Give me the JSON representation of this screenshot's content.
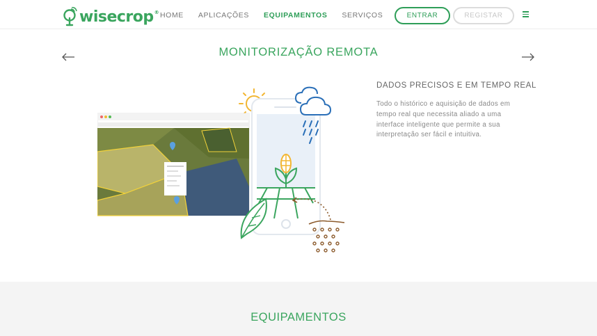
{
  "header": {
    "logo_text": "wisecrop",
    "logo_reg": "®",
    "nav": [
      {
        "label": "HOME",
        "active": false
      },
      {
        "label": "APLICAÇÕES",
        "active": false
      },
      {
        "label": "EQUIPAMENTOS",
        "active": true
      },
      {
        "label": "SERVIÇOS",
        "active": false
      }
    ],
    "login_label": "ENTRAR",
    "register_label": "REGISTAR",
    "menu_icon": "hamburger-icon"
  },
  "slider": {
    "title": "MONITORIZAÇÃO REMOTA",
    "prev_icon": "arrow-left-icon",
    "next_icon": "arrow-right-icon",
    "feature_title": "DADOS PRECISOS E EM TEMPO REAL",
    "feature_text": "Todo o histórico e aquisição de dados em tempo real que necessita aliado a uma interface inteligente que permite a sua interpretação ser fácil e intuitiva."
  },
  "bottom": {
    "title": "EQUIPAMENTOS"
  },
  "colors": {
    "brand_green": "#2e9e58",
    "light_green": "#3aa55e",
    "bottom_bg": "#f4f4f4"
  }
}
